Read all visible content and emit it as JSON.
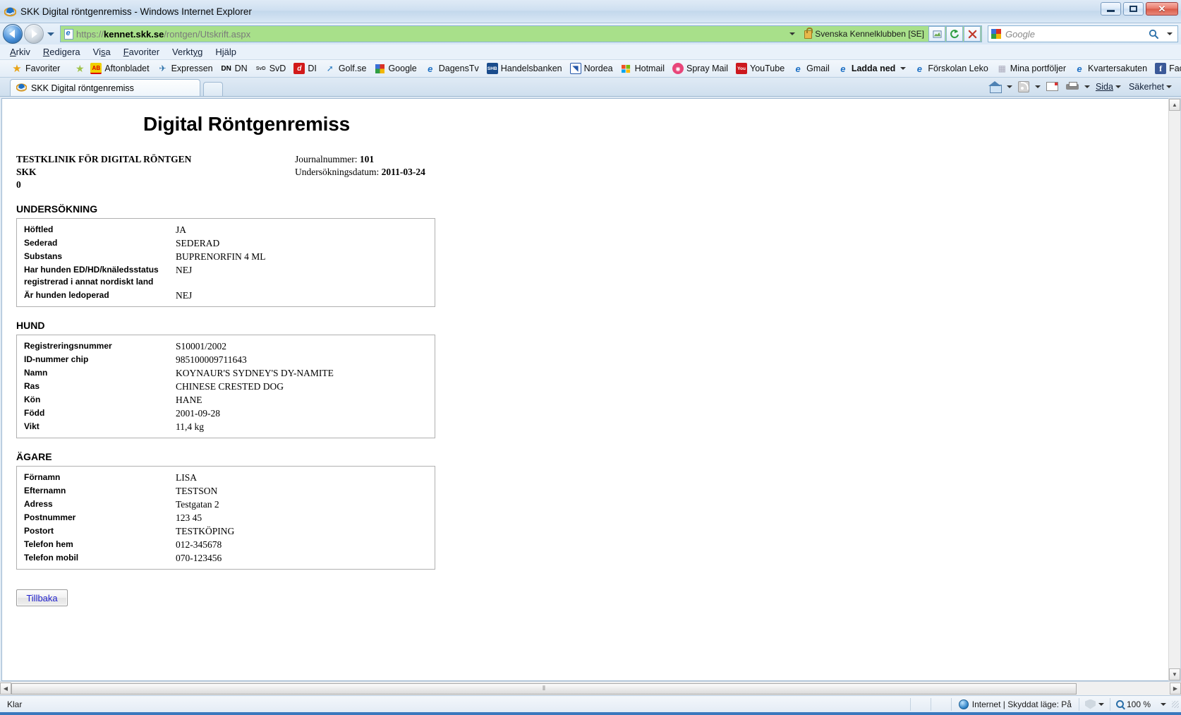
{
  "window": {
    "title": "SKK Digital röntgenremiss - Windows Internet Explorer",
    "minimize_label": "Minimera",
    "maximize_label": "Maximera",
    "close_label": "Stäng"
  },
  "nav": {
    "back_label": "Bakåt",
    "forward_label": "Framåt",
    "recent_pages_label": "Senaste sidor",
    "url_scheme": "https://",
    "url_host": "kennet.skk.se",
    "url_path": "/rontgen/Utskrift.aspx",
    "certificate_label": "Svenska Kennelklubben [SE]",
    "compat_label": "Kompatibilitetsvy",
    "refresh_label": "Uppdatera",
    "stop_label": "Stoppa",
    "search_placeholder": "Google",
    "search_value": ""
  },
  "menubar": {
    "items": [
      {
        "label": "Arkiv",
        "accel": "A"
      },
      {
        "label": "Redigera",
        "accel": "R"
      },
      {
        "label": "Visa",
        "accel": "s"
      },
      {
        "label": "Favoriter",
        "accel": "F"
      },
      {
        "label": "Verktyg",
        "accel": "y"
      },
      {
        "label": "Hjälp",
        "accel": "j"
      }
    ]
  },
  "favorites_bar": {
    "button_label": "Favoriter",
    "items": [
      {
        "label": "Aftonbladet",
        "icon": "aftonbladet-icon",
        "bold": false
      },
      {
        "label": "Expressen",
        "icon": "expressen-icon",
        "bold": false
      },
      {
        "label": "DN",
        "icon": "dn-icon",
        "bold": false
      },
      {
        "label": "SvD",
        "icon": "svd-icon",
        "bold": false
      },
      {
        "label": "DI",
        "icon": "di-icon",
        "bold": false
      },
      {
        "label": "Golf.se",
        "icon": "golf-icon",
        "bold": false
      },
      {
        "label": "Google",
        "icon": "google-icon",
        "bold": false
      },
      {
        "label": "DagensTv",
        "icon": "ie-page-icon",
        "bold": false
      },
      {
        "label": "Handelsbanken",
        "icon": "shb-icon",
        "bold": false
      },
      {
        "label": "Nordea",
        "icon": "nordea-icon",
        "bold": false
      },
      {
        "label": "Hotmail",
        "icon": "hotmail-icon",
        "bold": false
      },
      {
        "label": "Spray Mail",
        "icon": "spray-icon",
        "bold": false
      },
      {
        "label": "YouTube",
        "icon": "youtube-icon",
        "bold": false
      },
      {
        "label": "Gmail",
        "icon": "ie-page-icon",
        "bold": false
      },
      {
        "label": "Ladda ned",
        "icon": "ie-page-icon",
        "bold": true,
        "has_dropdown": true
      },
      {
        "label": "Förskolan Leko",
        "icon": "ie-page-icon",
        "bold": false
      },
      {
        "label": "Mina portföljer",
        "icon": "grid-icon",
        "bold": false
      },
      {
        "label": "Kvartersakuten",
        "icon": "ie-page-icon",
        "bold": false
      },
      {
        "label": "Facebook",
        "icon": "facebook-icon",
        "bold": false
      }
    ],
    "overflow_label": "»"
  },
  "tabs": {
    "active": "SKK Digital röntgenremiss",
    "new_tab_label": "Ny flik"
  },
  "command_bar": {
    "home_label": "Startsida",
    "feeds_label": "Feeds",
    "mail_label": "Läs e-post",
    "print_label": "Skriv ut",
    "page_label": "Sida",
    "safety_label": "Säkerhet"
  },
  "document": {
    "title": "Digital Röntgenremiss",
    "clinic_lines": [
      "TESTKLINIK FÖR DIGITAL RÖNTGEN",
      "SKK",
      "0"
    ],
    "meta": [
      {
        "label": "Journalnummer:",
        "value": "101"
      },
      {
        "label": "Undersökningsdatum:",
        "value": "2011-03-24"
      }
    ],
    "sections": [
      {
        "heading": "UNDERSÖKNING",
        "rows": [
          {
            "label": "Höftled",
            "value": "JA"
          },
          {
            "label": "Sederad",
            "value": "SEDERAD"
          },
          {
            "label": "Substans",
            "value": "BUPRENORFIN 4 ML"
          },
          {
            "label": "Har hunden ED/HD/knäledsstatus registrerad i annat nordiskt land",
            "value": "NEJ"
          },
          {
            "label": "Är hunden ledoperad",
            "value": "NEJ"
          }
        ]
      },
      {
        "heading": "HUND",
        "rows": [
          {
            "label": "Registreringsnummer",
            "value": "S10001/2002"
          },
          {
            "label": "ID-nummer chip",
            "value": "985100009711643"
          },
          {
            "label": "Namn",
            "value": "KOYNAUR'S SYDNEY'S DY-NAMITE"
          },
          {
            "label": "Ras",
            "value": "CHINESE CRESTED DOG"
          },
          {
            "label": "Kön",
            "value": "HANE"
          },
          {
            "label": "Född",
            "value": "2001-09-28"
          },
          {
            "label": "Vikt",
            "value": "11,4 kg"
          }
        ]
      },
      {
        "heading": "ÄGARE",
        "rows": [
          {
            "label": "Förnamn",
            "value": "LISA"
          },
          {
            "label": "Efternamn",
            "value": "TESTSON"
          },
          {
            "label": "Adress",
            "value": "Testgatan 2"
          },
          {
            "label": "Postnummer",
            "value": "123 45"
          },
          {
            "label": "Postort",
            "value": "TESTKÖPING"
          },
          {
            "label": "Telefon hem",
            "value": "012-345678"
          },
          {
            "label": "Telefon mobil",
            "value": "070-123456"
          }
        ]
      }
    ],
    "back_button": "Tillbaka"
  },
  "statusbar": {
    "status": "Klar",
    "zone": "Internet | Skyddat läge: På",
    "zoom": "100 %"
  },
  "colors": {
    "address_bar_secure": "#a8e08a",
    "link_blue": "#2222cc",
    "accent_blue": "#3a78bd"
  }
}
